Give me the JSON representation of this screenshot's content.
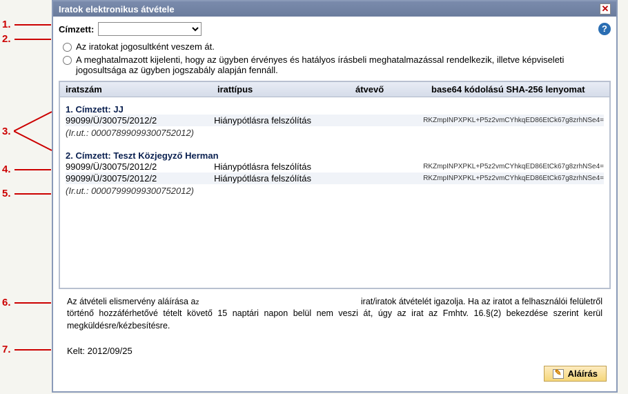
{
  "annotations": [
    "1.",
    "2.",
    "3.",
    "4.",
    "5.",
    "6.",
    "7."
  ],
  "window": {
    "title": "Iratok elektronikus átvétele",
    "close": "✕"
  },
  "form": {
    "cimzett_label": "Címzett:",
    "help": "?",
    "radio1": "Az iratokat jogosultként veszem át.",
    "radio2": "A meghatalmazott kijelenti, hogy az ügyben érvényes és hatályos írásbeli meghatalmazással rendelkezik, illetve képviseleti jogosultsága az ügyben jogszabály alapján fennáll."
  },
  "table": {
    "headers": {
      "iratszam": "iratszám",
      "irattipus": "irattípus",
      "atvevo": "átvevő",
      "sha": "base64 kódolású SHA-256 lenyomat"
    },
    "groups": [
      {
        "title": "1. Címzett: JJ",
        "rows": [
          {
            "iratszam": "99099/Ü/30075/2012/2",
            "irattipus": "Hiánypótlásra felszólítás",
            "atvevo": "",
            "sha": "RKZmpINPXPKL+P5z2vmCYhkqED86EtCk67g8zrhNSe4="
          }
        ],
        "irut": "(Ir.ut.: 00007899099300752012)"
      },
      {
        "title": "2. Címzett: Teszt Közjegyző Herman",
        "rows": [
          {
            "iratszam": "99099/Ü/30075/2012/2",
            "irattipus": "Hiánypótlásra felszólítás",
            "atvevo": "",
            "sha": "RKZmpINPXPKL+P5z2vmCYhkqED86EtCk67g8zrhNSe4="
          },
          {
            "iratszam": "99099/Ü/30075/2012/2",
            "irattipus": "Hiánypótlásra felszólítás",
            "atvevo": "",
            "sha": "RKZmpINPXPKL+P5z2vmCYhkqED86EtCk67g8zrhNSe4="
          }
        ],
        "irut": "(Ir.ut.: 00007999099300752012)"
      }
    ]
  },
  "footer": {
    "text_part1": "Az átvételi elismervény aláírása a",
    "text_sub": "z",
    "text_part2": "irat/iratok átvételét igazolja. Ha az iratot a felhasználói felületről történő hozzáférhetővé tételt követő 15 naptári napon belül nem veszi át, úgy az irat az Fmhtv. 16.§(2) bekezdése szerint kerül megküldésre/kézbesítésre.",
    "kelt_label": "Kelt:",
    "kelt_date": "2012/09/25"
  },
  "actions": {
    "sign": "Aláírás"
  }
}
